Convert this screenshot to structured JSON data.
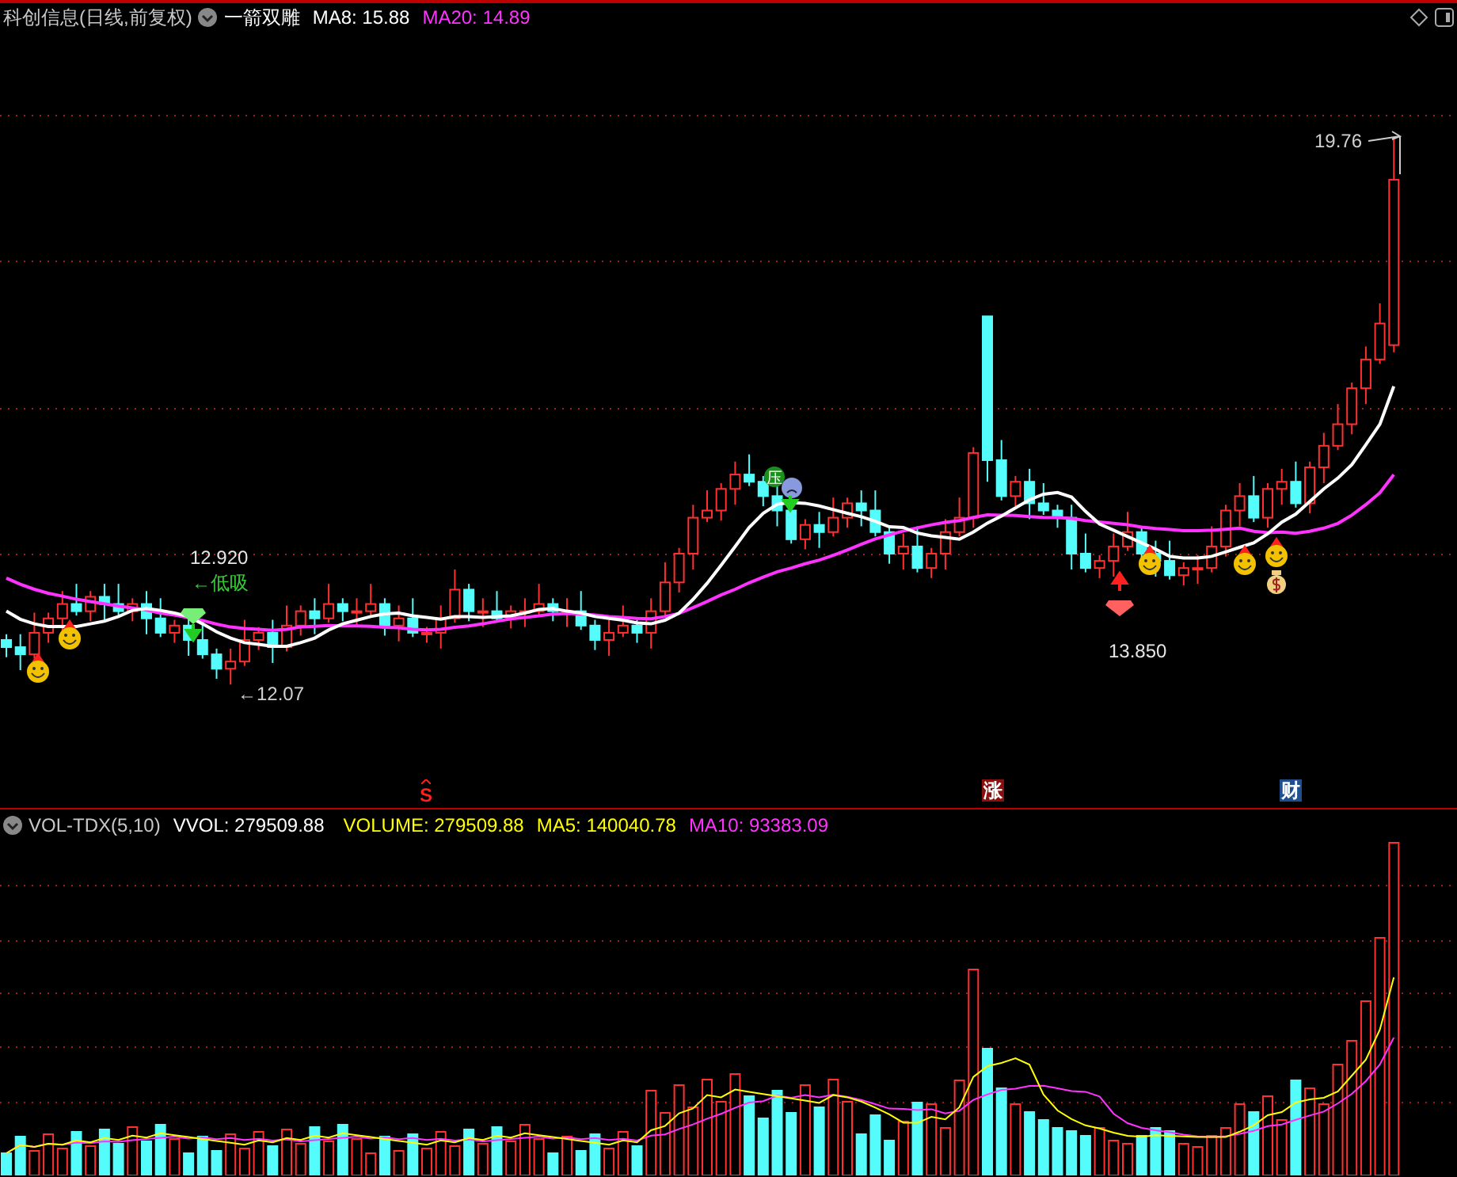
{
  "header": {
    "title": "科创信息(日线,前复权)",
    "indicator": "一箭双雕",
    "ma8": "MA8: 15.88",
    "ma20": "MA20: 14.89"
  },
  "main_chart": {
    "badge": "压",
    "annotations": [
      {
        "kind": "price",
        "text": "12.920"
      },
      {
        "kind": "signal",
        "text": "←低吸"
      },
      {
        "kind": "low",
        "text": "←12.07"
      },
      {
        "kind": "price",
        "text": "13.850"
      },
      {
        "kind": "high",
        "text": "19.76"
      }
    ]
  },
  "markers": [
    {
      "kind": "s",
      "text": "S"
    },
    {
      "kind": "zhang",
      "text": "涨"
    },
    {
      "kind": "cai",
      "text": "财"
    }
  ],
  "volume_panel": {
    "name": "VOL-TDX(5,10)",
    "vvol": "VVOL: 279509.88",
    "volume": "VOLUME: 279509.88",
    "ma5": "MA5: 140040.78",
    "ma10": "MA10: 93383.09"
  }
}
